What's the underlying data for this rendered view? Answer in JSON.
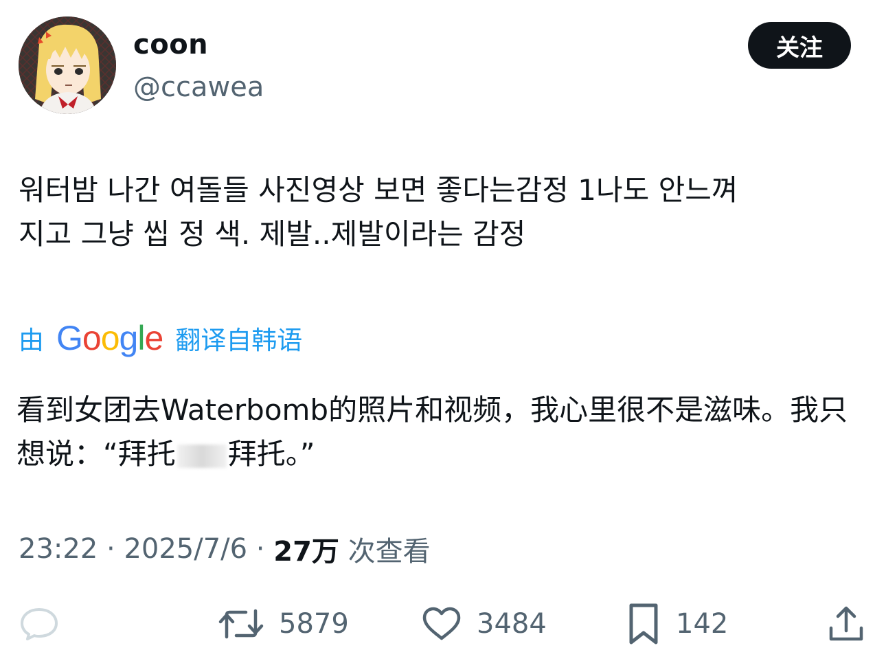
{
  "author": {
    "display_name": "coon",
    "handle": "@ccawea",
    "avatar_icon": "anime-avatar"
  },
  "follow_button": {
    "label": "关注"
  },
  "tweet": {
    "text": "워터밤 나간 여돌들 사진영상 보면 좋다는감정 1나도 안느껴\n지고 그냥 씹 정 색. 제발..제발이라는 감정"
  },
  "translation": {
    "by_label": "由",
    "provider_letters": [
      "G",
      "o",
      "o",
      "g",
      "l",
      "e"
    ],
    "suffix_label": "翻译自韩语",
    "text_part1": "看到女团去Waterbomb的照片和视频，我心里很不是滋味。我只想说：“拜托",
    "text_part2": "拜托。”"
  },
  "meta": {
    "time": "23:22",
    "separator": " · ",
    "date": "2025/7/6",
    "views_count": "27万",
    "views_label": " 次查看"
  },
  "actions": {
    "reply": {
      "icon": "reply-bubble-icon",
      "count": ""
    },
    "retweet": {
      "icon": "retweet-icon",
      "count": "5879"
    },
    "like": {
      "icon": "heart-icon",
      "count": "3484"
    },
    "bookmark": {
      "icon": "bookmark-icon",
      "count": "142"
    },
    "share": {
      "icon": "share-icon"
    }
  },
  "colors": {
    "text_primary": "#0f1419",
    "text_secondary": "#536471",
    "link_blue": "#1d9bf0",
    "reply_icon_gray": "#cfd9de"
  }
}
